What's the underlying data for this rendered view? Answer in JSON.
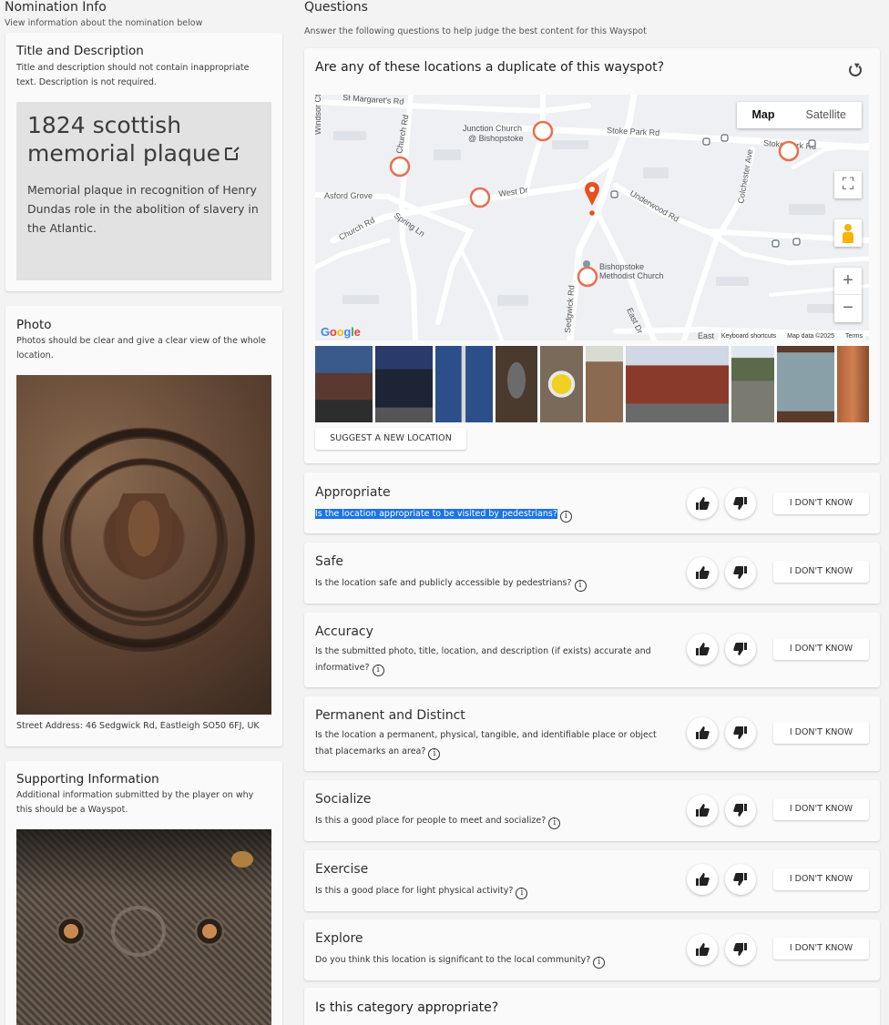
{
  "nomination": {
    "heading": "Nomination Info",
    "subheading": "View information about the nomination below",
    "title_desc": {
      "title": "Title and Description",
      "description": "Title and description should not contain inappropriate text. Description is not required.",
      "nom_title": "1824 scottish memorial plaque",
      "nom_description": "Memorial plaque in recognition of Henry Dundas role in the abolition of slavery in the Atlantic."
    },
    "photo": {
      "title": "Photo",
      "description": "Photos should be clear and give a clear view of the whole location.",
      "address": "Street Address: 46 Sedgwick Rd, Eastleigh SO50 6FJ, UK"
    },
    "supporting": {
      "title": "Supporting Information",
      "description": "Additional information submitted by the player on why this should be a Wayspot."
    }
  },
  "questions": {
    "heading": "Questions",
    "subheading": "Answer the following questions to help judge the best content for this Wayspot",
    "duplicate": {
      "question": "Are any of these locations a duplicate of this wayspot?",
      "map_tab": "Map",
      "satellite_tab": "Satellite",
      "google": "Google",
      "keyboard": "Keyboard shortcuts",
      "map_data": "Map data ©2025",
      "terms": "Terms",
      "suggest_label": "SUGGEST A NEW LOCATION",
      "map_labels": {
        "st_margarets": "St Margaret's Rd",
        "church_rd_top": "Church Rd",
        "junction_church": "Junction Church",
        "junction_church2": "@ Bishopstoke",
        "stoke_park": "Stoke Park Rd",
        "stoke_park2": "Stoke Park Rd",
        "colchester": "Colchester Ave",
        "asford": "Asford Grove",
        "west_dr": "West Dr",
        "underwood": "Underwood Rd",
        "church_rd_low": "Church Rd",
        "spring_ln": "Spring Ln",
        "methodist1": "Bishopstoke",
        "methodist2": "Methodist Church",
        "sedgwick": "Sedgwick Rd",
        "east_dr": "East Dr",
        "east": "East",
        "windsor": "Windsor Ct"
      }
    },
    "items": [
      {
        "label": "Appropriate",
        "text": "Is the location appropriate to be visited by pedestrians?",
        "idk": "I DON'T KNOW"
      },
      {
        "label": "Safe",
        "text": "Is the location safe and publicly accessible by pedestrians?",
        "idk": "I DON'T KNOW"
      },
      {
        "label": "Accuracy",
        "text": "Is the submitted photo, title, location, and description (if exists) accurate and informative?",
        "idk": "I DON'T KNOW"
      },
      {
        "label": "Permanent and Distinct",
        "text": "Is the location a permanent, physical, tangible, and identifiable place or object that placemarks an area?",
        "idk": "I DON'T KNOW"
      },
      {
        "label": "Socialize",
        "text": "Is this a good place for people to meet and socialize?",
        "idk": "I DON'T KNOW"
      },
      {
        "label": "Exercise",
        "text": "Is this a good place for light physical activity?",
        "idk": "I DON'T KNOW"
      },
      {
        "label": "Explore",
        "text": "Do you think this location is significant to the local community?",
        "idk": "I DON'T KNOW"
      }
    ],
    "category": {
      "question": "Is this category appropriate?"
    }
  },
  "icons": {
    "info": "i",
    "external": "external-link-icon",
    "refresh": "refresh-icon",
    "thumbs_up": "thumbs-up-icon",
    "thumbs_down": "thumbs-down-icon"
  },
  "colors": {
    "selection": "#1a73e8",
    "pin": "#e8501f",
    "marker": "#e8704f"
  }
}
